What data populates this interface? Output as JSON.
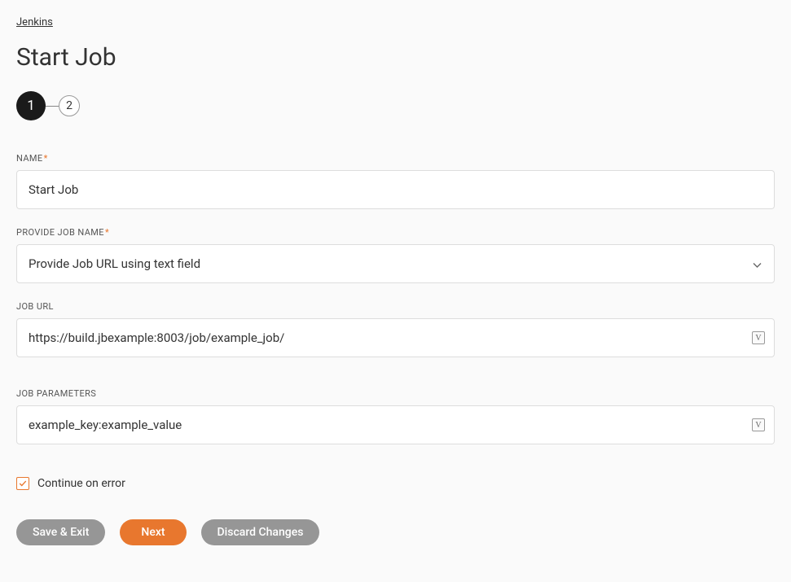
{
  "breadcrumb": {
    "jenkins": "Jenkins"
  },
  "title": "Start Job",
  "stepper": {
    "step1": "1",
    "step2": "2"
  },
  "fields": {
    "name": {
      "label": "NAME",
      "required": "*",
      "value": "Start Job"
    },
    "provideJobName": {
      "label": "PROVIDE JOB NAME",
      "required": "*",
      "value": "Provide Job URL using text field"
    },
    "jobUrl": {
      "label": "JOB URL",
      "value": "https://build.jbexample:8003/job/example_job/"
    },
    "jobParameters": {
      "label": "JOB PARAMETERS",
      "value": "example_key:example_value"
    }
  },
  "checkbox": {
    "label": "Continue on error"
  },
  "buttons": {
    "saveExit": "Save & Exit",
    "next": "Next",
    "discard": "Discard Changes"
  }
}
